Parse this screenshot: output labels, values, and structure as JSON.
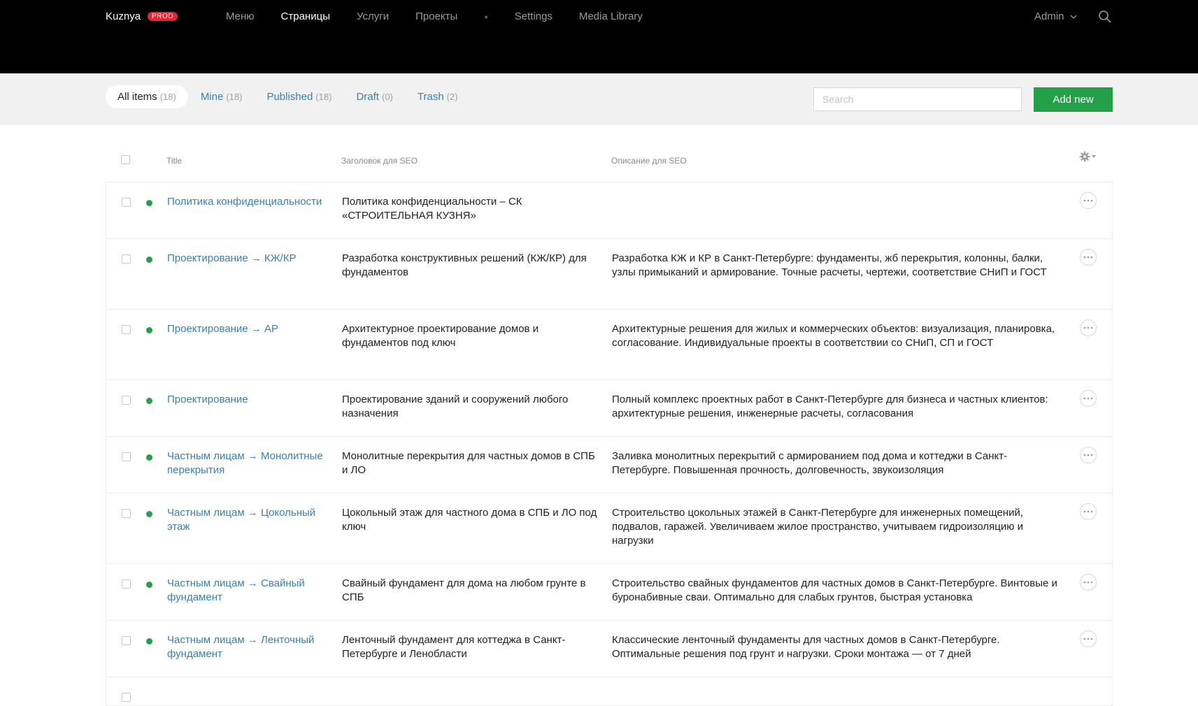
{
  "brand": {
    "name": "Kuznya",
    "badge": "PROD"
  },
  "nav": {
    "items": [
      "Меню",
      "Страницы",
      "Услуги",
      "Проекты",
      "Settings",
      "Media Library"
    ],
    "active": "Страницы"
  },
  "user": {
    "name": "Admin"
  },
  "filters": {
    "tabs": [
      {
        "label": "All items",
        "count": "(18)"
      },
      {
        "label": "Mine",
        "count": "(18)"
      },
      {
        "label": "Published",
        "count": "(18)"
      },
      {
        "label": "Draft",
        "count": "(0)"
      },
      {
        "label": "Trash",
        "count": "(2)"
      }
    ],
    "active": "All items",
    "search_placeholder": "Search",
    "add_button": "Add new"
  },
  "table": {
    "columns": {
      "title": "Title",
      "seo_title": "Заголовок для SEO",
      "seo_desc": "Описание для SEO"
    },
    "rows": [
      {
        "title": "Политика конфиденциальности",
        "seo_title": "Политика конфиденциальности – СК «СТРОИТЕЛЬНАЯ КУЗНЯ»",
        "seo_desc": ""
      },
      {
        "title": "Проектирование → КЖ/КР",
        "seo_title": "Разработка конструктивных решений (КЖ/КР) для фундаментов",
        "seo_desc": "Разработка КЖ и КР в Санкт-Петербурге: фундаменты, жб перекрытия, колонны, балки, узлы примыканий и армирование. Точные расчеты, чертежи, соответствие СНиП и ГОСТ"
      },
      {
        "title": "Проектирование → АР",
        "seo_title": "Архитектурное проектирование домов и фундаментов под ключ",
        "seo_desc": "Архитектурные решения для жилых и коммерческих объектов: визуализация, планировка, согласование. Индивидуальные проекты в соответствии со СНиП, СП и ГОСТ"
      },
      {
        "title": "Проектирование",
        "seo_title": "Проектирование зданий и сооружений любого назначения",
        "seo_desc": "Полный комплекс проектных работ в Санкт-Петербурге для бизнеса и частных клиентов: архитектурные решения, инженерные расчеты, согласования"
      },
      {
        "title": "Частным лицам → Монолитные перекрытия",
        "seo_title": "Монолитные перекрытия для частных домов в СПБ и ЛО",
        "seo_desc": "Заливка монолитных перекрытий с армированием под дома и коттеджи в Санкт-Петербурге. Повышенная прочность, долговечность, звукоизоляция"
      },
      {
        "title": "Частным лицам → Цокольный этаж",
        "seo_title": "Цокольный этаж для частного дома в СПБ и ЛО под ключ",
        "seo_desc": "Строительство цокольных этажей в Санкт-Петербурге для инженерных помещений, подвалов, гаражей. Увеличиваем жилое пространство, учитываем гидроизоляцию и нагрузки"
      },
      {
        "title": "Частным лицам → Свайный фундамент",
        "seo_title": "Свайный фундамент для дома на любом грунте в СПБ",
        "seo_desc": "Строительство свайных фундаментов для частных домов в Санкт-Петербурге. Винтовые и буронабивные сваи. Оптимально для слабых грунтов, быстрая установка"
      },
      {
        "title": "Частным лицам → Ленточный фундамент",
        "seo_title": "Ленточный фундамент для коттеджа в Санкт-Петербурге и Ленобласти",
        "seo_desc": "Классические ленточный фундаменты для частных домов в Санкт-Петербурге. Оптимальные решения под грунт и нагрузки. Сроки монтажа — от 7 дней"
      }
    ]
  }
}
